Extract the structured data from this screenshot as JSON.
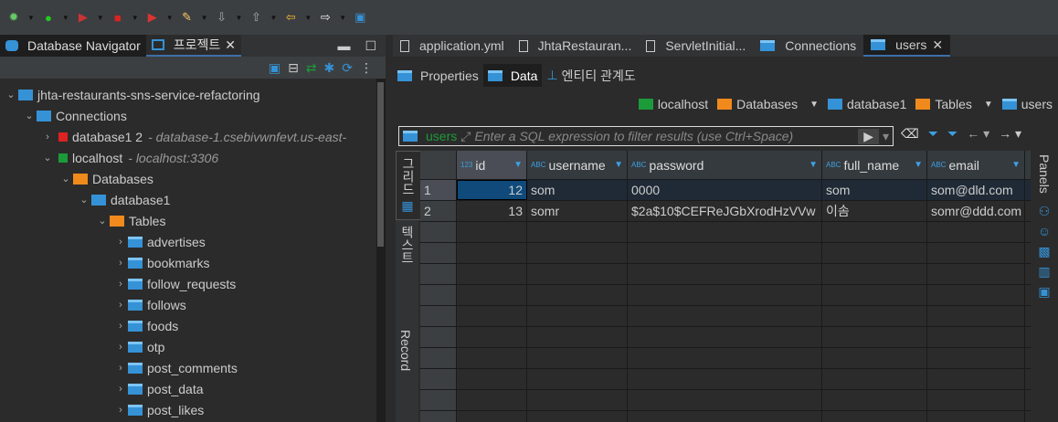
{
  "toolbar": {
    "icons": [
      "debug-icon",
      "run-icon",
      "run-server-icon",
      "stop-icon",
      "stop-run-icon",
      "pen-icon",
      "import-icon",
      "export-icon",
      "back-icon",
      "forward-icon",
      "edit-icon"
    ]
  },
  "left": {
    "tabs": [
      {
        "label": "Database Navigator"
      },
      {
        "label": "프로젝트"
      }
    ],
    "tree": [
      {
        "label": "jhta-restaurants-sns-service-refactoring",
        "depth": 0,
        "open": true,
        "icon": "project",
        "color": "#3592d6"
      },
      {
        "label": "Connections",
        "depth": 1,
        "open": true,
        "icon": "db",
        "color": "#3592d6"
      },
      {
        "label": "database1 2",
        "detail": "- database-1.csebivwnfevt.us-east-",
        "depth": 2,
        "open": false,
        "icon": "conn-error",
        "color": "#d22"
      },
      {
        "label": "localhost",
        "detail": "- localhost:3306",
        "depth": 2,
        "open": true,
        "icon": "conn-ok",
        "color": "#1c9b3a"
      },
      {
        "label": "Databases",
        "depth": 3,
        "open": true,
        "icon": "folder",
        "color": "#f08a1c"
      },
      {
        "label": "database1",
        "depth": 4,
        "open": true,
        "icon": "db",
        "color": "#3592d6"
      },
      {
        "label": "Tables",
        "depth": 5,
        "open": true,
        "icon": "folder",
        "color": "#f08a1c"
      },
      {
        "label": "advertises",
        "depth": 6,
        "open": false,
        "icon": "table"
      },
      {
        "label": "bookmarks",
        "depth": 6,
        "open": false,
        "icon": "table"
      },
      {
        "label": "follow_requests",
        "depth": 6,
        "open": false,
        "icon": "table"
      },
      {
        "label": "follows",
        "depth": 6,
        "open": false,
        "icon": "table"
      },
      {
        "label": "foods",
        "depth": 6,
        "open": false,
        "icon": "table"
      },
      {
        "label": "otp",
        "depth": 6,
        "open": false,
        "icon": "table"
      },
      {
        "label": "post_comments",
        "depth": 6,
        "open": false,
        "icon": "table"
      },
      {
        "label": "post_data",
        "depth": 6,
        "open": false,
        "icon": "table"
      },
      {
        "label": "post_likes",
        "depth": 6,
        "open": false,
        "icon": "table"
      }
    ]
  },
  "editor": {
    "tabs": [
      {
        "label": "application.yml"
      },
      {
        "label": "JhtaRestauran..."
      },
      {
        "label": "ServletInitial..."
      },
      {
        "label": "Connections"
      },
      {
        "label": "users"
      }
    ],
    "subtabs": [
      {
        "label": "Properties"
      },
      {
        "label": "Data"
      },
      {
        "label": "엔티티 관계도"
      }
    ],
    "breadcrumb": [
      "localhost",
      "Databases",
      "database1",
      "Tables",
      "users"
    ],
    "filter": {
      "table": "users",
      "placeholder": "Enter a SQL expression to filter results (use Ctrl+Space)"
    },
    "vtabs": [
      "그리드",
      "텍스트",
      "Record"
    ],
    "panels": "Panels",
    "columns": [
      {
        "name": "id",
        "type": "123"
      },
      {
        "name": "username",
        "type": "ABC"
      },
      {
        "name": "password",
        "type": "ABC"
      },
      {
        "name": "full_name",
        "type": "ABC"
      },
      {
        "name": "email",
        "type": "ABC"
      }
    ],
    "rows": [
      {
        "n": "1",
        "cells": [
          "12",
          "som",
          "0000",
          "som",
          "som@dld.com"
        ]
      },
      {
        "n": "2",
        "cells": [
          "13",
          "somr",
          "$2a$10$CEFReJGbXrodHzVVw",
          "이솜",
          "somr@ddd.com"
        ]
      }
    ]
  }
}
